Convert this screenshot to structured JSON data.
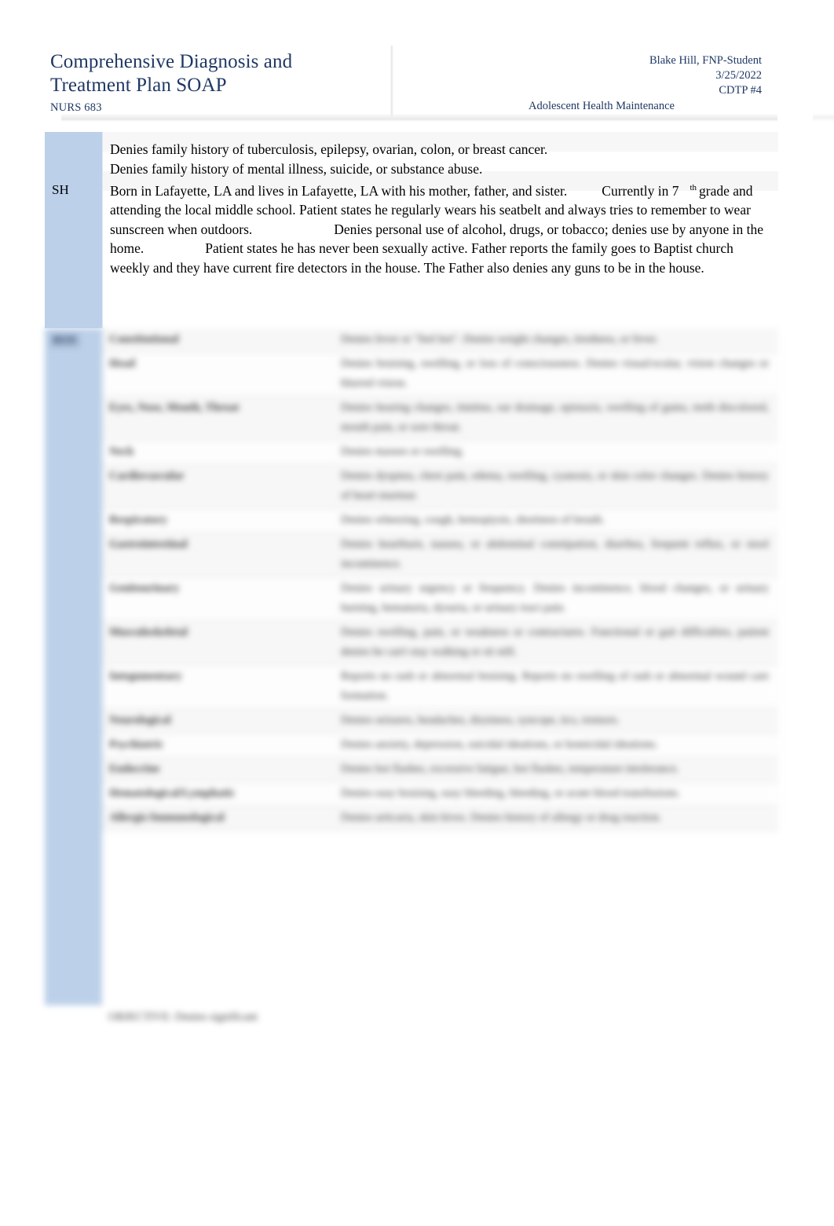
{
  "header": {
    "title_line_1": "Comprehensive Diagnosis and",
    "title_line_2": "Treatment Plan SOAP",
    "course_code": "NURS 683",
    "author": "Blake Hill, FNP-Student",
    "date": "3/25/2022",
    "assignment": "CDTP #4",
    "topic": "Adolescent Health Maintenance",
    "accent_color": "#1f3864"
  },
  "colors": {
    "label_column_blue": "#bcd0e9",
    "title_navy": "#1f3864",
    "row_stripe_gray": "#f7f7f7",
    "body_text": "#000000"
  },
  "social_history": {
    "label": "SH",
    "family_history_lines": [
      "Denies family history of tuberculosis, epilepsy, ovarian, colon, or breast cancer.",
      "Denies family history of mental illness, suicide, or substance abuse."
    ],
    "paragraph_segments": {
      "s1": "Born in Lafayette, LA and lives in Lafayette, LA with his mother, father, and sister.",
      "s2": "Currently in 7",
      "sup": "th",
      "s3": "grade and attending the local middle school. Patient states he regularly wears his seatbelt and always tries to remember to wear sunscreen when outdoors.",
      "s4": "Denies personal use of alcohol, drugs, or tobacco; denies use by anyone in the home.",
      "s5": "Patient states he has never been sexually active. Father reports the family goes to Baptist church weekly and they have current fire detectors in the house. The Father also denies any guns to be in the house."
    }
  },
  "review_of_systems": {
    "label": "ROS",
    "rows": [
      {
        "system": "Constitutional",
        "findings": "Denies fever or \"feel hot\". Denies weight changes, tiredness, or fever."
      },
      {
        "system": "Head",
        "findings": "Denies bruising, swelling, or loss of consciousness. Denies visual/ocular, vision changes or blurred vision."
      },
      {
        "system": "Eyes, Nose, Mouth, Throat",
        "findings": "Denies hearing changes, tinnitus, ear drainage, epistaxis, swelling of gums, teeth discolored, mouth pain, or sore throat."
      },
      {
        "system": "Neck",
        "findings": "Denies masses or swelling."
      },
      {
        "system": "Cardiovascular",
        "findings": "Denies dyspnea, chest pain, edema, swelling, cyanosis, or skin color changes. Denies history of heart murmur."
      },
      {
        "system": "Respiratory",
        "findings": "Denies wheezing, cough, hemoptysis, shortness of breath."
      },
      {
        "system": "Gastrointestinal",
        "findings": "Denies heartburn, nausea, or abdominal constipation, diarrhea, frequent reflux, or stool incontinence."
      },
      {
        "system": "Genitourinary",
        "findings": "Denies urinary urgency or frequency. Denies incontinence, blood changes, or urinary burning, hematuria, dysuria, or urinary tract pain."
      },
      {
        "system": "Musculoskeletal",
        "findings": "Denies swelling, pain, or weakness or contractures. Functional or gait difficulties, patient denies he can't stay walking or sit still."
      },
      {
        "system": "Integumentary",
        "findings": "Reports no rash or abnormal bruising. Reports no swelling of rash or abnormal wound care formation."
      },
      {
        "system": "Neurological",
        "findings": "Denies seizures, headaches, dizziness, syncope, tics, tremors."
      },
      {
        "system": "Psychiatric",
        "findings": "Denies anxiety, depression, suicidal ideations, or homicidal ideations."
      },
      {
        "system": "Endocrine",
        "findings": "Denies hot flashes, excessive fatigue, hot flashes, temperature intolerance."
      },
      {
        "system": "Hematological/Lymphatic",
        "findings": "Denies easy bruising, easy bleeding, bleeding, or acute blood transfusions."
      },
      {
        "system": "Allergic/Immunological",
        "findings": "Denies urticaria, skin hives. Denies history of allergy or drug reaction."
      }
    ],
    "footnote": "OBJECTIVE: Denies significant"
  }
}
